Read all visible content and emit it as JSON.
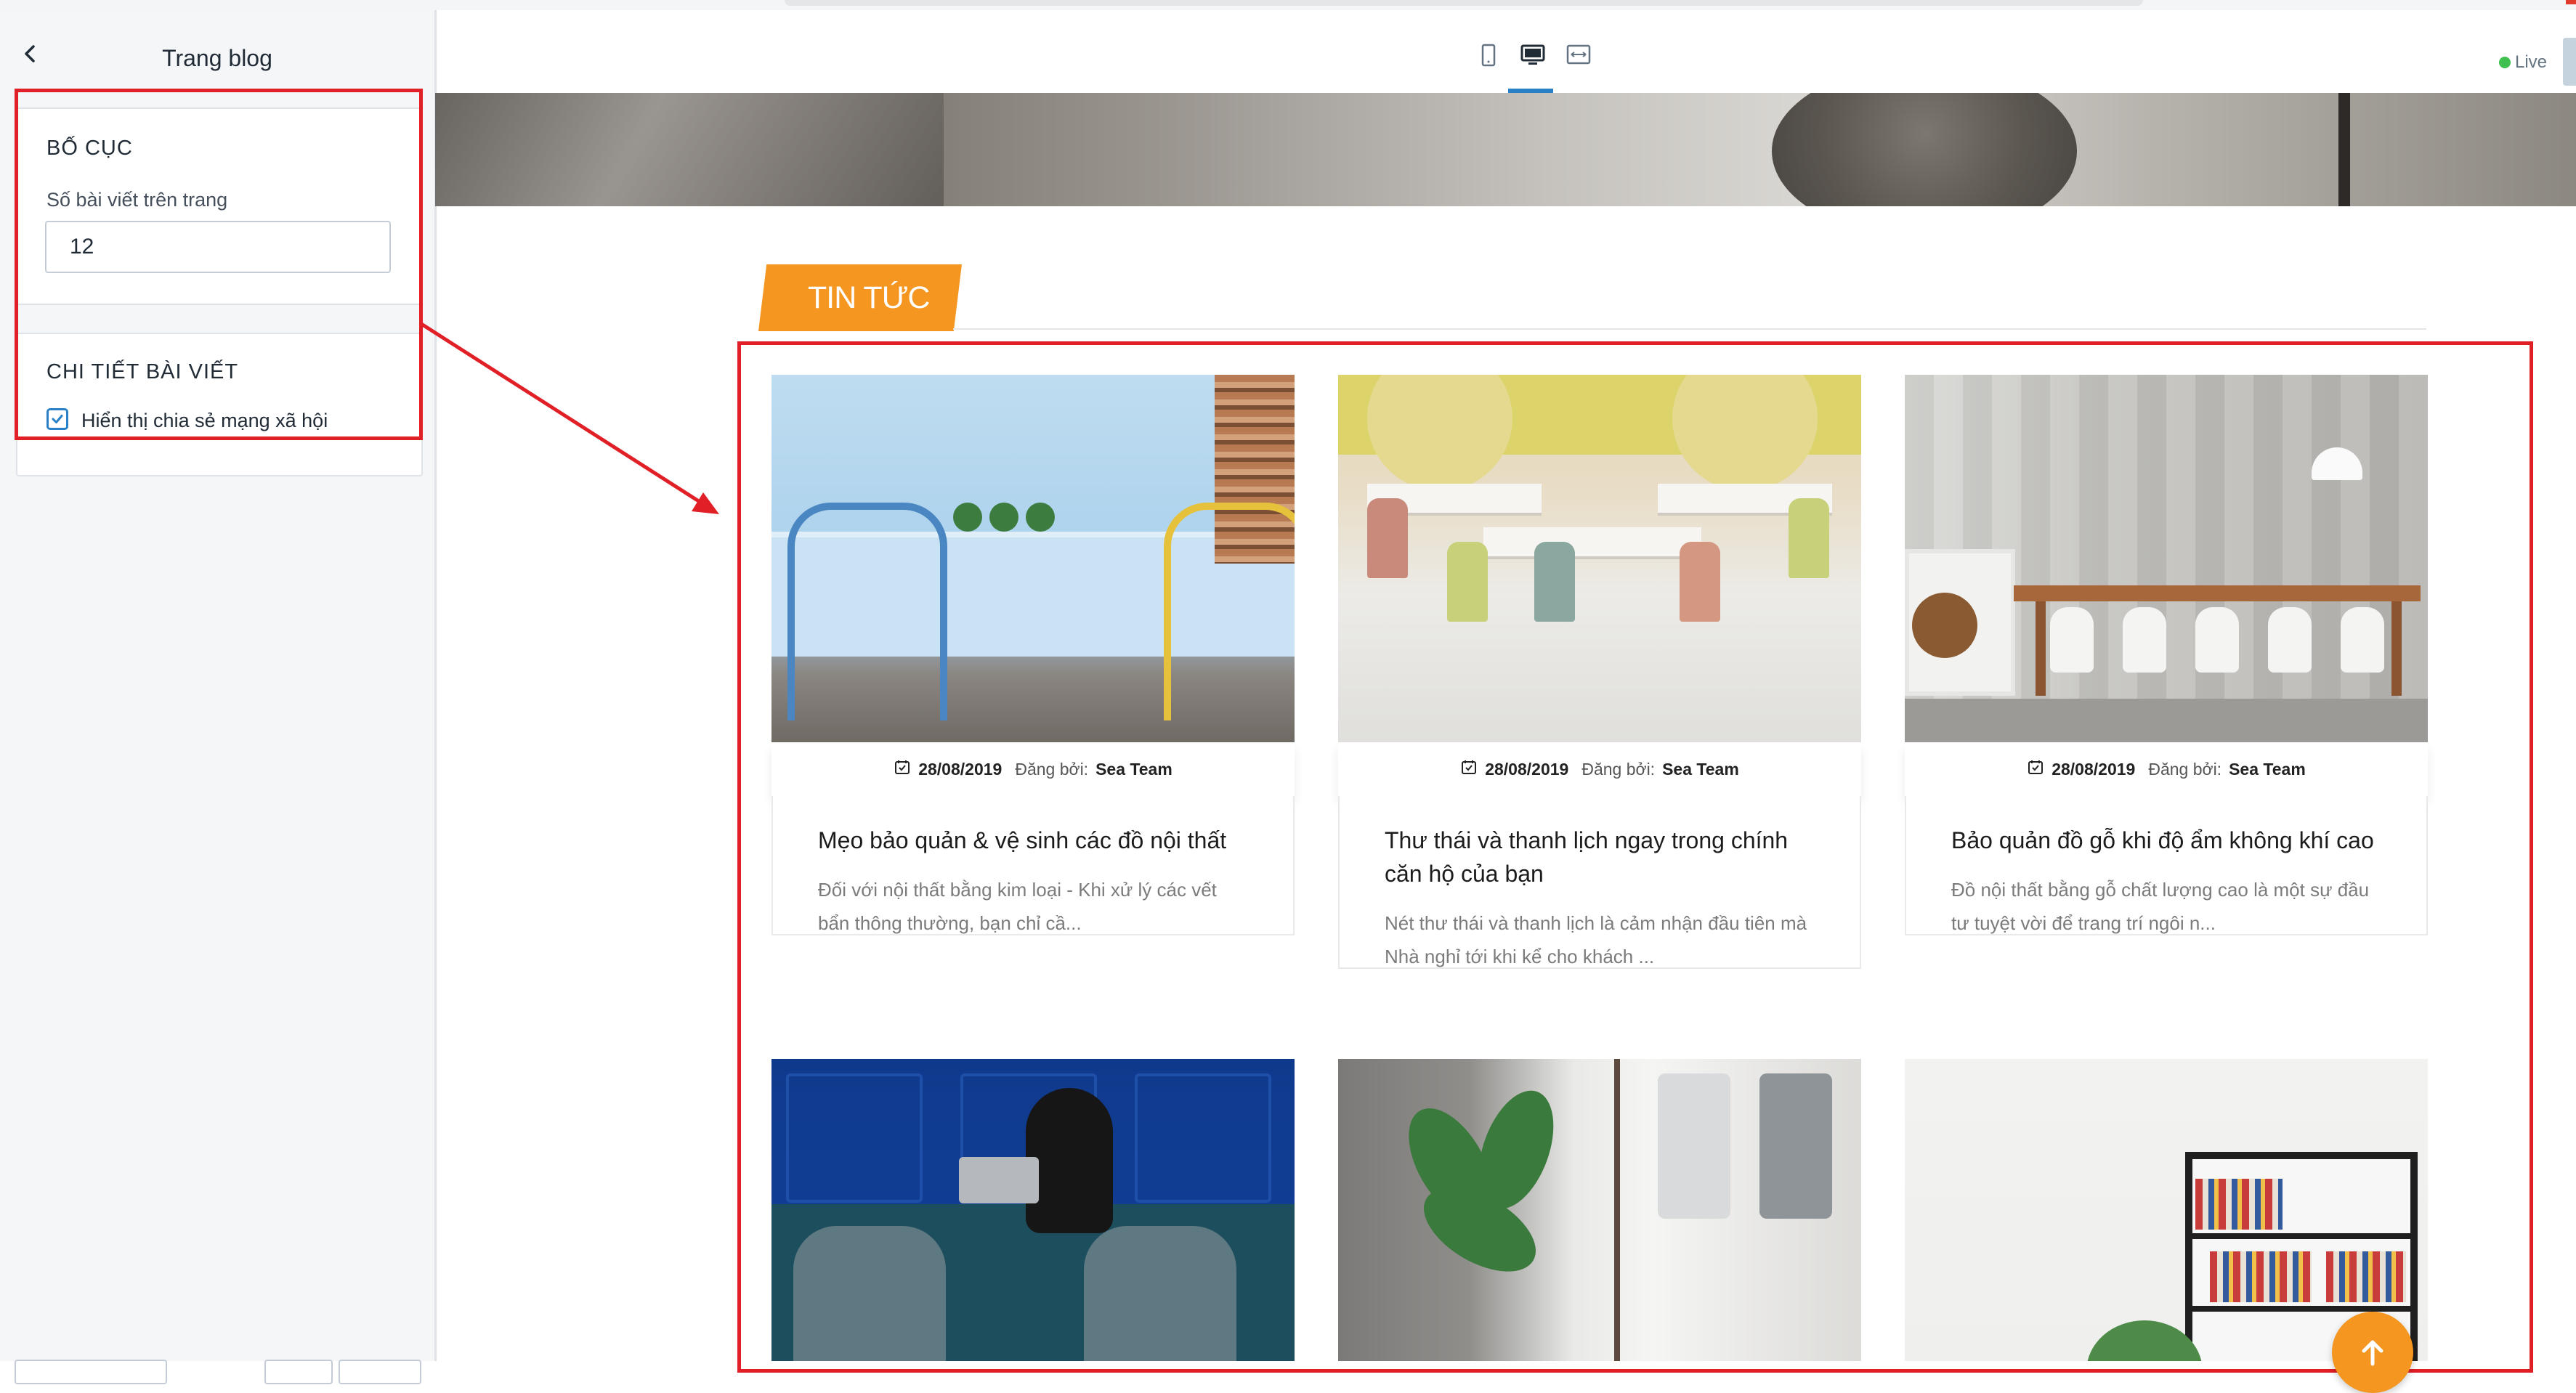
{
  "sidebar": {
    "title": "Trang blog",
    "layout_section": {
      "title": "BỐ CỤC",
      "posts_per_page_label": "Số bài viết trên trang",
      "posts_per_page_value": "12"
    },
    "article_section": {
      "title": "CHI TIẾT BÀI VIẾT",
      "show_social_share_label": "Hiển thị chia sẻ mạng xã hội",
      "show_social_share_checked": true
    }
  },
  "toolbar": {
    "devices": [
      "mobile-icon",
      "desktop-icon",
      "fullwidth-icon"
    ],
    "active_device": "desktop-icon",
    "status_label": "Live",
    "status_color": "#3fbf4f"
  },
  "blog": {
    "section_title": "TIN TỨC",
    "accent_color": "#f4961f",
    "posted_by_label": "Đăng bởi:",
    "posts": [
      {
        "date": "28/08/2019",
        "author": "Sea Team",
        "title": "Mẹo bảo quản & vệ sinh các đồ nội thất",
        "excerpt": "Đối với nội thất bằng kim loại - Khi xử lý các vết bẩn thông thường, bạn chỉ cầ..."
      },
      {
        "date": "28/08/2019",
        "author": "Sea Team",
        "title": "Thư thái và thanh lịch ngay trong chính căn hộ của bạn",
        "excerpt": "Nét thư thái và thanh lịch là cảm nhận đầu tiên mà Nhà nghỉ tới khi kể cho khách ..."
      },
      {
        "date": "28/08/2019",
        "author": "Sea Team",
        "title": "Bảo quản đồ gỗ khi độ ẩm không khí cao",
        "excerpt": "Đồ nội thất bằng gỗ chất lượng cao là một sự đầu tư tuyệt vời để trang trí ngôi n..."
      }
    ]
  },
  "annotation_color": "#e01f26"
}
